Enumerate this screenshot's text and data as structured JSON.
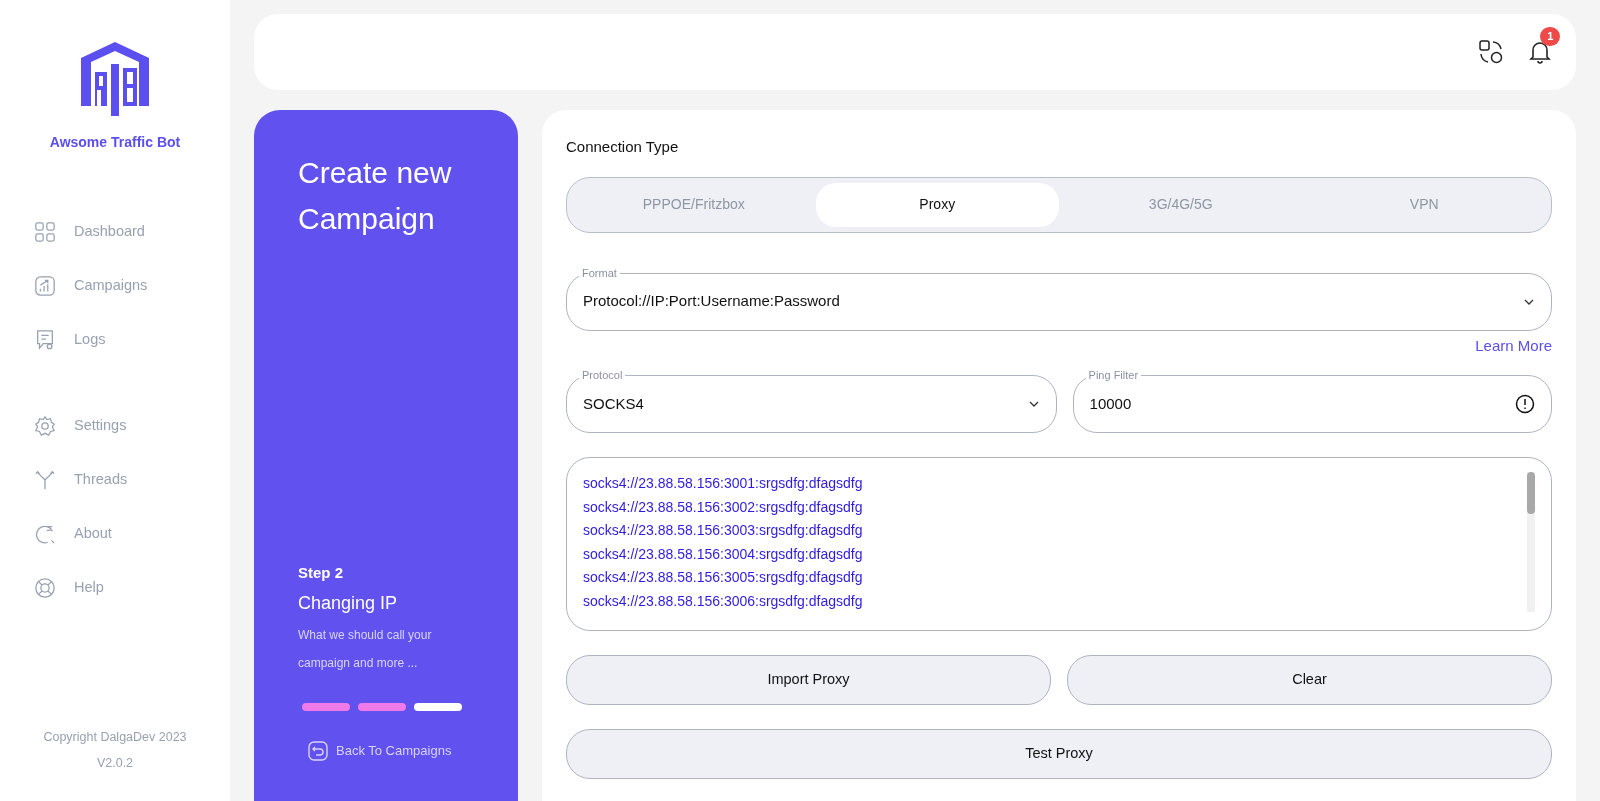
{
  "brand": {
    "name": "Awsome Traffic Bot"
  },
  "sidebar": {
    "groups": [
      [
        {
          "label": "Dashboard",
          "kind": "grid"
        },
        {
          "label": "Campaigns",
          "kind": "chart"
        },
        {
          "label": "Logs",
          "kind": "log"
        }
      ],
      [
        {
          "label": "Settings",
          "kind": "gear"
        },
        {
          "label": "Threads",
          "kind": "fork"
        },
        {
          "label": "About",
          "kind": "about"
        },
        {
          "label": "Help",
          "kind": "help"
        }
      ]
    ],
    "copyright": "Copyright DalgaDev 2023",
    "version": "V2.0.2"
  },
  "header": {
    "notifications": "1"
  },
  "wizard": {
    "title": "Create new Campaign",
    "step": "Step 2",
    "step_title": "Changing IP",
    "description": "What we should call your campaign and more ...",
    "steps": [
      {
        "done": true
      },
      {
        "done": true
      },
      {
        "done": false
      }
    ],
    "back": "Back To Campaigns"
  },
  "form": {
    "connection_label": "Connection Type",
    "tabs": [
      {
        "label": "PPPOE/Fritzbox",
        "selected": false
      },
      {
        "label": "Proxy",
        "selected": true
      },
      {
        "label": "3G/4G/5G",
        "selected": false
      },
      {
        "label": "VPN",
        "selected": false
      }
    ],
    "format": {
      "label": "Format",
      "value": "Protocol://IP:Port:Username:Password"
    },
    "learn_more": "Learn More",
    "protocol": {
      "label": "Protocol",
      "value": "SOCKS4"
    },
    "ping": {
      "label": "Ping Filter",
      "value": "10000"
    },
    "proxies": [
      "socks4://23.88.58.156:3001:srgsdfg:dfagsdfg",
      "socks4://23.88.58.156:3002:srgsdfg:dfagsdfg",
      "socks4://23.88.58.156:3003:srgsdfg:dfagsdfg",
      "socks4://23.88.58.156:3004:srgsdfg:dfagsdfg",
      "socks4://23.88.58.156:3005:srgsdfg:dfagsdfg",
      "socks4://23.88.58.156:3006:srgsdfg:dfagsdfg"
    ],
    "buttons": [
      "Import Proxy",
      "Clear"
    ],
    "test_button": "Test Proxy"
  }
}
